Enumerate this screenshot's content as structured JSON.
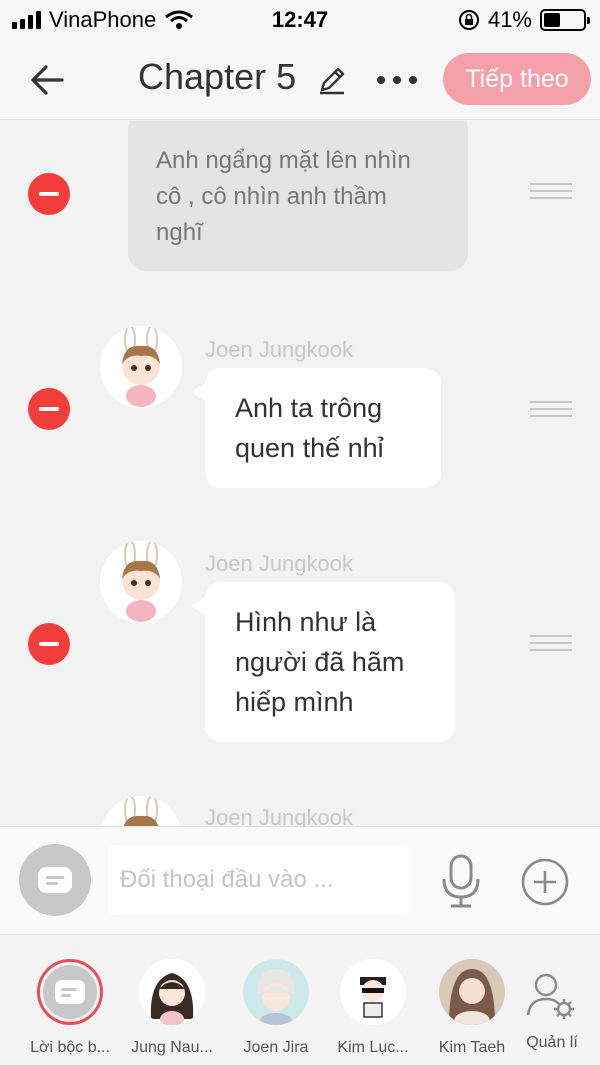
{
  "status_bar": {
    "carrier": "VinaPhone",
    "time": "12:47",
    "battery": "41%",
    "battery_level": 0.41
  },
  "header": {
    "title": "Chapter 5",
    "next_label": "Tiếp theo",
    "accent_color": "#f5a0a8"
  },
  "chat": {
    "narration_text": "Anh ngẩng mặt lên nhìn cô , cô nhìn anh thầm nghĩ",
    "messages": [
      {
        "speaker": "Joen Jungkook",
        "text": "Anh ta trông quen thế nhỉ"
      },
      {
        "speaker": "Joen Jungkook",
        "text": "Hình như là người đã hãm hiếp mình"
      },
      {
        "speaker": "Joen Jungkook",
        "text": ""
      }
    ]
  },
  "input": {
    "placeholder": "Đối thoại đầu vào ..."
  },
  "characters": [
    {
      "name": "Lời bộc b...",
      "icon": "narration-icon"
    },
    {
      "name": "Jung Nau..."
    },
    {
      "name": "Joen Jira"
    },
    {
      "name": "Kim Lục..."
    },
    {
      "name": "Kim Taeh"
    },
    {
      "name": "Quản lí",
      "icon": "person-gear-icon"
    }
  ]
}
